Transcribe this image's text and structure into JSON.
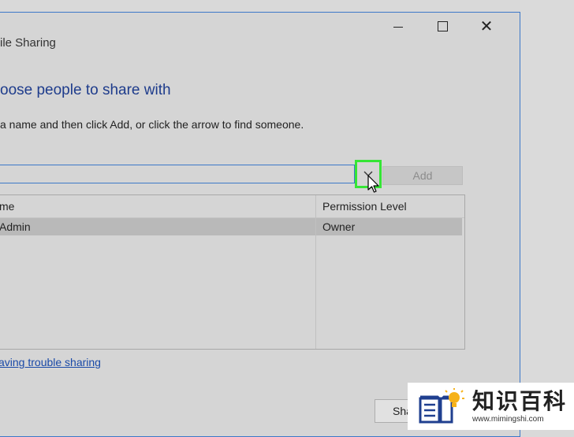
{
  "window": {
    "title": "ile Sharing",
    "controls": {
      "minimize": "minimize",
      "maximize": "maximize",
      "close": "✕"
    }
  },
  "main": {
    "heading": "oose people to share with",
    "instructions": "a name and then click Add, or click the arrow to find someone.",
    "name_input": {
      "value": "",
      "placeholder": ""
    },
    "add_label": "Add",
    "table": {
      "columns": [
        "me",
        "Permission Level"
      ],
      "rows": [
        {
          "name": "Admin",
          "permission": "Owner"
        }
      ]
    },
    "help_link": "aving trouble sharing",
    "share_label": "Sha"
  },
  "watermark": {
    "chinese": "知识百科",
    "url": "www.mimingshi.com"
  },
  "colors": {
    "accent": "#3c78c8",
    "heading": "#1e3c8c",
    "highlight": "#35e535",
    "link": "#1a4aa8"
  },
  "icons": [
    "chevron-down-icon",
    "mouse-cursor-icon",
    "book-lightbulb-icon",
    "close-icon"
  ]
}
